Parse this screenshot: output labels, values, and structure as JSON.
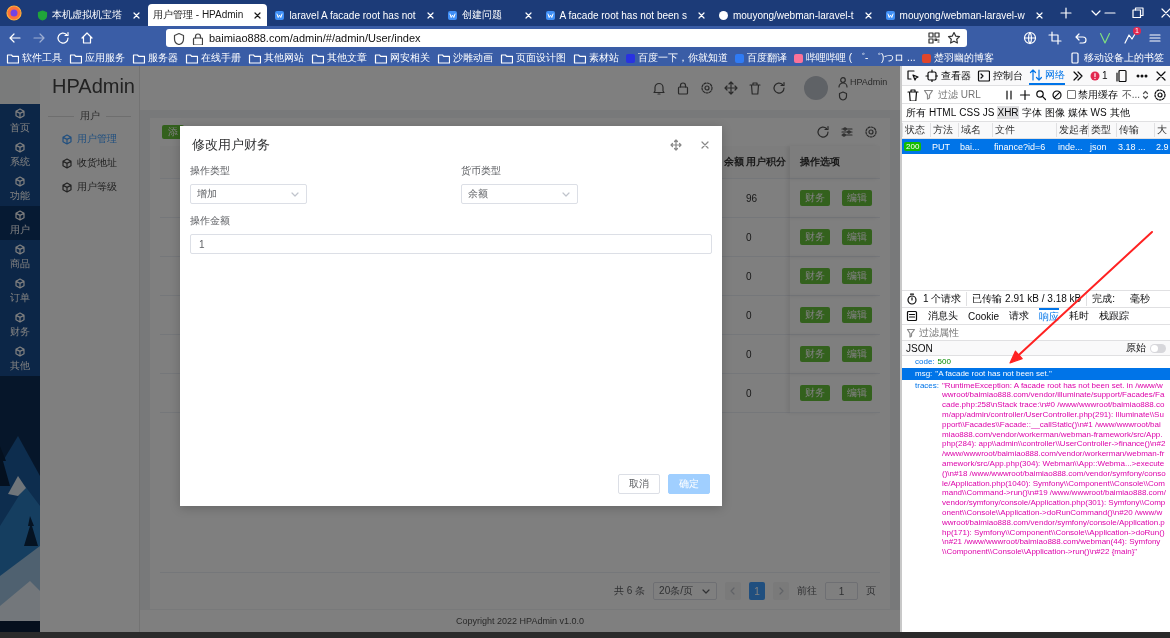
{
  "browser": {
    "tabs": [
      {
        "title": "本机虚拟机宝塔",
        "kind": "shield",
        "selected": false
      },
      {
        "title": "用户管理 - HPAdmin",
        "kind": "none",
        "selected": true
      },
      {
        "title": "laravel A facade root has not",
        "kind": "square",
        "selected": false
      },
      {
        "title": "创建问题",
        "kind": "square",
        "selected": false
      },
      {
        "title": "A facade root has not been s",
        "kind": "square",
        "selected": false
      },
      {
        "title": "mouyong/webman-laravel-t",
        "kind": "round",
        "selected": false
      },
      {
        "title": "mouyong/webman-laravel-w",
        "kind": "square",
        "selected": false
      }
    ],
    "address": "baimiao888.com/admin/#/admin/User/index",
    "extension_badge": "1",
    "bookmarks": [
      {
        "label": "软件工具",
        "kind": "folder"
      },
      {
        "label": "应用服务",
        "kind": "folder"
      },
      {
        "label": "服务器",
        "kind": "folder"
      },
      {
        "label": "在线手册",
        "kind": "folder"
      },
      {
        "label": "其他网站",
        "kind": "folder"
      },
      {
        "label": "其他文章",
        "kind": "folder"
      },
      {
        "label": "网安相关",
        "kind": "folder"
      },
      {
        "label": "沙雕动画",
        "kind": "folder"
      },
      {
        "label": "页面设计图",
        "kind": "folder"
      },
      {
        "label": "素材站",
        "kind": "folder"
      },
      {
        "label": "百度一下，你就知道",
        "kind": "site",
        "color": "#2932e1"
      },
      {
        "label": "百度翻译",
        "kind": "site",
        "color": "#2f7bf5"
      },
      {
        "label": "哔哩哔哩 ( ゜- ゜)つロ ...",
        "kind": "site",
        "color": "#fb7299"
      },
      {
        "label": "楚羽幽的博客",
        "kind": "site",
        "color": "#e0452b"
      }
    ],
    "mobile_bookmarks": "移动设备上的书签"
  },
  "admin": {
    "rail": [
      {
        "label": "首页",
        "selected": false
      },
      {
        "label": "系统",
        "selected": false
      },
      {
        "label": "功能",
        "selected": false
      },
      {
        "label": "用户",
        "selected": true
      },
      {
        "label": "商品",
        "selected": false
      },
      {
        "label": "订单",
        "selected": false
      },
      {
        "label": "财务",
        "selected": false
      },
      {
        "label": "其他",
        "selected": false
      }
    ],
    "logo": "HPAdmin",
    "menu_group": "用户",
    "menu": [
      {
        "label": "用户管理",
        "selected": true
      },
      {
        "label": "收货地址",
        "selected": false
      },
      {
        "label": "用户等级",
        "selected": false
      }
    ],
    "user_name": "HPAdmin",
    "add_button": "添",
    "table": {
      "columns": [
        "余额",
        "用户积分",
        "操作选项"
      ],
      "rows": [
        {
          "points": "96",
          "actions": [
            "财务",
            "编辑"
          ]
        },
        {
          "points": "0",
          "actions": [
            "财务",
            "编辑"
          ]
        },
        {
          "points": "0",
          "actions": [
            "财务",
            "编辑"
          ]
        },
        {
          "points": "0",
          "actions": [
            "财务",
            "编辑"
          ]
        },
        {
          "points": "0",
          "actions": [
            "财务",
            "编辑"
          ]
        },
        {
          "points": "0",
          "actions": [
            "财务",
            "编辑"
          ]
        }
      ]
    },
    "pagination": {
      "total": "共 6 条",
      "page_size": "20条/页",
      "pages": [
        {
          "label": "1",
          "selected": true
        }
      ],
      "goto": "前往",
      "goto_value": "1",
      "page_unit": "页"
    },
    "footer": "Copyright 2022 HPAdmin v1.0.0"
  },
  "dialog": {
    "title": "修改用户财务",
    "fields": [
      {
        "label": "操作类型",
        "kind": "select",
        "value": "增加"
      },
      {
        "label": "货币类型",
        "kind": "select",
        "value": "余额"
      },
      {
        "label": "操作金额",
        "kind": "input",
        "value": "1"
      }
    ],
    "buttons": [
      {
        "label": "取消",
        "kind": "default",
        "disabled": false
      },
      {
        "label": "确定",
        "kind": "primary",
        "disabled": true
      }
    ]
  },
  "devtools": {
    "tabs": [
      {
        "label": "查看器",
        "selected": false
      },
      {
        "label": "控制台",
        "selected": false
      },
      {
        "label": "网络",
        "selected": true
      }
    ],
    "error_count": "1",
    "filter_placeholder": "过滤 URL",
    "disable_cache": {
      "label": "禁用缓存",
      "checked": false
    },
    "throttle": "不...",
    "types": [
      {
        "label": "所有",
        "selected": false
      },
      {
        "label": "HTML",
        "selected": false
      },
      {
        "label": "CSS",
        "selected": false
      },
      {
        "label": "JS",
        "selected": false
      },
      {
        "label": "XHR",
        "selected": true
      },
      {
        "label": "字体",
        "selected": false
      },
      {
        "label": "图像",
        "selected": false
      },
      {
        "label": "媒体",
        "selected": false
      },
      {
        "label": "WS",
        "selected": false
      },
      {
        "label": "其他",
        "selected": false
      }
    ],
    "columns": [
      "状态",
      "方法",
      "域名",
      "文件",
      "发起者",
      "类型",
      "传输",
      "大"
    ],
    "requests": [
      {
        "status": "200",
        "method": "PUT",
        "domain": "bai...",
        "file": "finance?id=6",
        "initiator": "inde...",
        "type": "json",
        "transferred": "3.18 ...",
        "size": "2.9",
        "selected": true
      }
    ],
    "summary": [
      "1 个请求",
      "已传输 2.91 kB / 3.18 kB",
      "完成:",
      "毫秒"
    ],
    "detail_tabs": [
      {
        "label": "消息头",
        "selected": false
      },
      {
        "label": "Cookie",
        "selected": false
      },
      {
        "label": "请求",
        "selected": false
      },
      {
        "label": "响应",
        "selected": true
      },
      {
        "label": "耗时",
        "selected": false
      },
      {
        "label": "栈跟踪",
        "selected": false
      }
    ],
    "filter_props": {
      "placeholder": "过滤属性"
    },
    "view": "JSON",
    "raw": {
      "label": "原始",
      "on": false
    },
    "json": [
      {
        "key": "code:",
        "value": "500",
        "kind": "number",
        "selected": false
      },
      {
        "key": "msg:",
        "value": "\"A facade root has not been set.\"",
        "kind": "string",
        "selected": true
      },
      {
        "key": "traces:",
        "value": "\"RuntimeException: A facade root has not been set. in /www/wwwroot/baimiao888.com/vendor/illuminate/support/Facades/Facade.php:258\\nStack trace:\\n#0 /www/wwwroot/baimiao888.com/app/admin/controller/UserController.php(291): Illuminate\\\\Support\\\\Facades\\\\Facade::__callStatic()\\n#1 /www/wwwroot/baimiao888.com/vendor/workerman/webman-framework/src/App.php(284): app\\\\admin\\\\controller\\\\UserController->finance()\\n#2 /www/wwwroot/baimiao888.com/vendor/workerman/webman-framework/src/App.php(304): Webman\\\\App::Webma...>execute()\\n#18 /www/wwwroot/baimiao888.com/vendor/symfony/console/Application.php(1040): Symfony\\\\Component\\\\Console\\\\Command\\\\Command->run()\\n#19 /www/wwwroot/baimiao888.com/vendor/symfony/console/Application.php(301): Symfony\\\\Component\\\\Console\\\\Application->doRunCommand()\\n#20 /www/wwwroot/baimiao888.com/vendor/symfony/console/Application.php(171): Symfony\\\\Component\\\\Console\\\\Application->doRun()\\n#21 /www/wwwroot/baimiao888.com/webman(44): Symfony\\\\Component\\\\Console\\\\Application->run()\\n#22 {main}\"",
        "kind": "string",
        "selected": false
      }
    ]
  }
}
